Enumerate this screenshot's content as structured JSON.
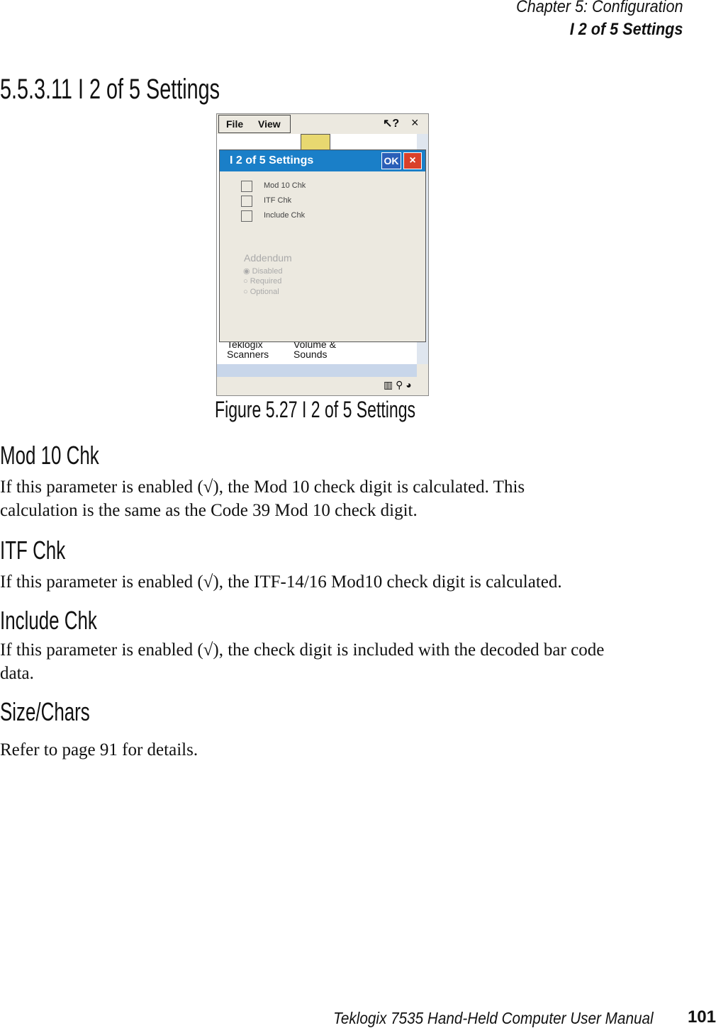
{
  "header": {
    "chapter": "Chapter  5:  Configuration",
    "section": "I 2 of 5 Settings"
  },
  "section_title": "5.5.3.11    I 2 of 5 Settings",
  "screenshot": {
    "menu": [
      "File",
      "View"
    ],
    "help_icon": "pointer-help-icon",
    "close": "×",
    "dialog_title": "I 2 of 5 Settings",
    "ok": "OK",
    "cancel": "×",
    "checkboxes": [
      {
        "label": "Mod 10 Chk",
        "checked": false
      },
      {
        "label": "ITF Chk",
        "checked": false
      },
      {
        "label": "Include Chk",
        "checked": false
      }
    ],
    "addendum": {
      "label": "Addendum",
      "options": [
        {
          "label": "Disabled",
          "selected": true
        },
        {
          "label": "Required",
          "selected": false
        },
        {
          "label": "Optional",
          "selected": false
        }
      ]
    },
    "desktop_items": [
      "Teklogix Scanners",
      "Volume & Sounds"
    ],
    "colors": {
      "title_bar": "#1a7fc8",
      "cancel": "#d9402a"
    }
  },
  "caption": "Figure  5.27  I 2  of  5  Settings",
  "sections": [
    {
      "heading": "Mod  10  Chk",
      "text": "If this parameter is enabled (√), the Mod 10 check digit is calculated. This calculation is the same as the Code 39 Mod 10 check digit."
    },
    {
      "heading": "ITF  Chk",
      "text": "If this parameter is enabled (√), the ITF-14/16 Mod10 check digit is calculated."
    },
    {
      "heading": "Include  Chk",
      "text": "If this parameter is enabled (√), the check digit is included with the decoded bar code data."
    },
    {
      "heading": "Size/Chars",
      "text": "Refer to page 91 for details."
    }
  ],
  "footer": {
    "title": "Teklogix 7535 Hand-Held Computer User Manual",
    "page": "101"
  }
}
